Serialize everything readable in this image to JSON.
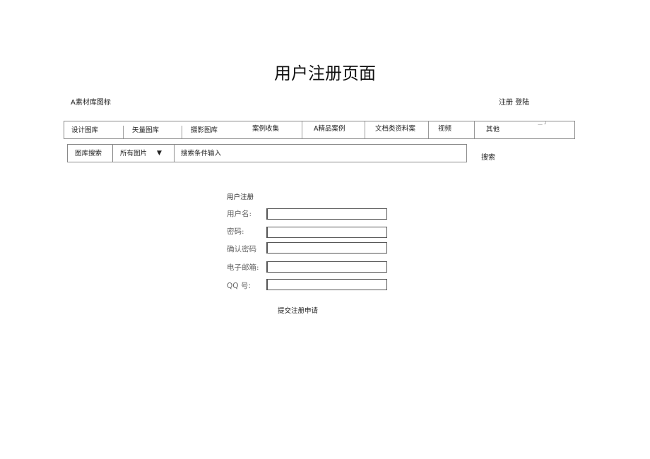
{
  "page": {
    "title": "用户注册页面"
  },
  "header": {
    "logo": "A素材库图标",
    "register_label": "注册",
    "login_label": "登陆"
  },
  "nav": {
    "items": [
      {
        "label": "设计图库"
      },
      {
        "label": "矢量图库"
      },
      {
        "label": "摄影图库"
      },
      {
        "label": "案例收集"
      },
      {
        "label": "A精品案例"
      },
      {
        "label": "文档类资料案"
      },
      {
        "label": "视频"
      },
      {
        "label": "其他"
      }
    ]
  },
  "search": {
    "label": "图库搜索",
    "category_selected": "所有图片",
    "dropdown_icon": "▼",
    "placeholder": "搜索条件输入",
    "button_label": "搜索"
  },
  "form": {
    "title": "用户注册",
    "fields": [
      {
        "label": "用户名:",
        "value": ""
      },
      {
        "label": "密码:",
        "value": ""
      },
      {
        "label": "确认密码",
        "value": ""
      },
      {
        "label": "电子邮箱:",
        "value": ""
      },
      {
        "label": "QQ 号:",
        "value": ""
      }
    ],
    "submit_label": "提交注册申请"
  }
}
